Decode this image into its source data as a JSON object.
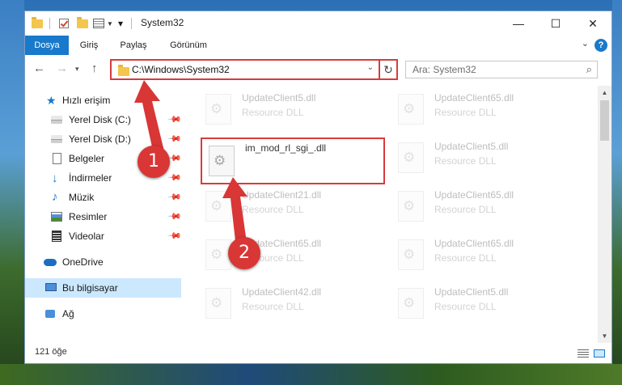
{
  "window": {
    "title": "System32"
  },
  "ribbon": {
    "tabs": [
      "Dosya",
      "Giriş",
      "Paylaş",
      "Görünüm"
    ]
  },
  "nav": {
    "address": "C:\\Windows\\System32",
    "search_placeholder": "Ara: System32"
  },
  "sidebar": {
    "items": [
      {
        "label": "Hızlı erişim",
        "icon": "star-icon"
      },
      {
        "label": "Yerel Disk (C:)",
        "icon": "drive-icon"
      },
      {
        "label": "Yerel Disk (D:)",
        "icon": "drive-icon"
      },
      {
        "label": "Belgeler",
        "icon": "document-icon"
      },
      {
        "label": "İndirmeler",
        "icon": "download-icon"
      },
      {
        "label": "Müzik",
        "icon": "music-icon"
      },
      {
        "label": "Resimler",
        "icon": "pictures-icon"
      },
      {
        "label": "Videolar",
        "icon": "video-icon"
      },
      {
        "label": "OneDrive",
        "icon": "cloud-icon"
      },
      {
        "label": "Bu bilgisayar",
        "icon": "computer-icon"
      },
      {
        "label": "Ağ",
        "icon": "network-icon"
      }
    ]
  },
  "files": [
    {
      "name": "UpdateClient5.dll",
      "type": "Resource DLL"
    },
    {
      "name": "UpdateClient65.dll",
      "type": "Resource DLL"
    },
    {
      "name": "im_mod_rl_sgi_.dll",
      "type": ""
    },
    {
      "name": "UpdateClient5.dll",
      "type": "Resource DLL"
    },
    {
      "name": "UpdateClient21.dll",
      "type": "Resource DLL"
    },
    {
      "name": "UpdateClient65.dll",
      "type": "Resource DLL"
    },
    {
      "name": "UpdateClient65.dll",
      "type": "Resource DLL"
    },
    {
      "name": "UpdateClient65.dll",
      "type": "Resource DLL"
    },
    {
      "name": "UpdateClient42.dll",
      "type": "Resource DLL"
    },
    {
      "name": "UpdateClient5.dll",
      "type": "Resource DLL"
    }
  ],
  "status": {
    "count": "121 öğe"
  },
  "annotations": [
    "1",
    "2"
  ],
  "colors": {
    "accent": "#1979ca",
    "annotation": "#d93636",
    "selection": "#cce8ff"
  }
}
